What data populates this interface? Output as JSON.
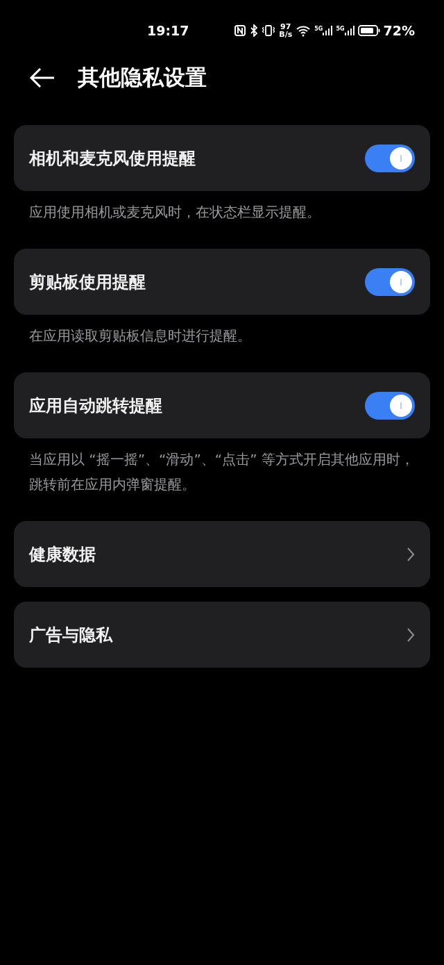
{
  "status_bar": {
    "time": "19:17",
    "net_speed_value": "97",
    "net_speed_unit": "B/s",
    "sim1_label": "5G",
    "sim2_label": "5G",
    "battery": "72%"
  },
  "header": {
    "title": "其他隐私设置"
  },
  "items": [
    {
      "kind": "switch",
      "label": "相机和麦克风使用提醒",
      "on": true,
      "description": "应用使用相机或麦克风时，在状态栏显示提醒。"
    },
    {
      "kind": "switch",
      "label": "剪贴板使用提醒",
      "on": true,
      "description": "在应用读取剪贴板信息时进行提醒。"
    },
    {
      "kind": "switch",
      "label": "应用自动跳转提醒",
      "on": true,
      "description": "当应用以 “摇一摇”、“滑动”、“点击” 等方式开启其他应用时，跳转前在应用内弹窗提醒。"
    },
    {
      "kind": "link",
      "label": "健康数据"
    },
    {
      "kind": "link",
      "label": "广告与隐私"
    }
  ]
}
